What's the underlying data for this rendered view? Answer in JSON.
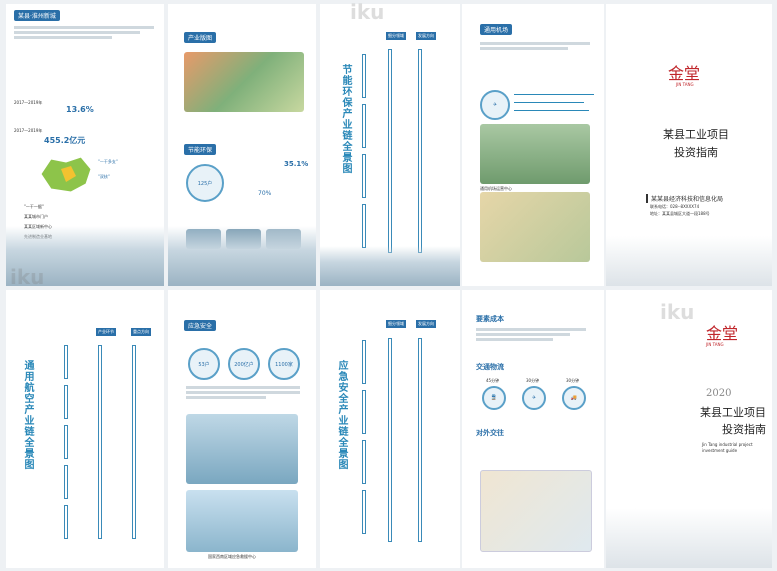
{
  "watermark": "iku",
  "brand": {
    "logo_glyph": "金堂",
    "logo_sub": "JIN TANG",
    "color": "#c0262b"
  },
  "cover_top": {
    "title_line1": "某县工业项目",
    "title_line2": "投资指南",
    "org": "某某县经济科技和信息化局",
    "phone": "联系电话：028--8XXXX74",
    "address": "地址：某某县城区大道一段188号"
  },
  "cover_bottom": {
    "year": "2020",
    "title_line1": "某县工业项目",
    "title_line2": "投资指南",
    "en_line1": "Jin Tang industrial project",
    "en_line2": "investment guide"
  },
  "panel_city": {
    "title": "某县·淮州新城",
    "stat1": "13.6%",
    "stat1_label": "2017—2019年",
    "stat2": "455.2亿元",
    "stat2_label": "2017—2019年",
    "map_labels": [
      "国家级新区",
      "\"一干多支\"",
      "\"双核\""
    ],
    "bullets": [
      "\"一干一据\"",
      "某某城市门户",
      "某某区域新中心",
      "先进制造业基地"
    ]
  },
  "panel_industry": {
    "title": "产业版图",
    "subtitle": "节能环保",
    "pct1": "35.1%",
    "pct2": "70%",
    "center_value": "125户"
  },
  "panel_chain1": {
    "vertical_title": "节能环保产业链全景图",
    "col_heads": [
      "细分领域",
      "发展方向"
    ]
  },
  "panel_policy": {
    "title": "通用机场",
    "photo_caption": "通用机场运营中心"
  },
  "panel_chain2": {
    "vertical_title": "通用航空产业链全景图",
    "col_heads": [
      "产业环节",
      "重点方向"
    ]
  },
  "panel_safety": {
    "title": "应急安全",
    "stats": [
      "53户",
      "200亿户",
      "1100家"
    ],
    "caption": "国家西南区域应急救援中心"
  },
  "panel_chain3": {
    "vertical_title": "应急安全产业链全景图",
    "col_heads": [
      "细分领域",
      "发展方向"
    ]
  },
  "panel_cost": {
    "title1": "要素成本",
    "title2": "交通物流",
    "title3": "对外交往",
    "times": [
      "45分钟",
      "30分钟",
      "30分钟"
    ]
  },
  "colors": {
    "primary": "#2a6fa8",
    "accent": "#2a88b8",
    "red": "#c0262b"
  }
}
